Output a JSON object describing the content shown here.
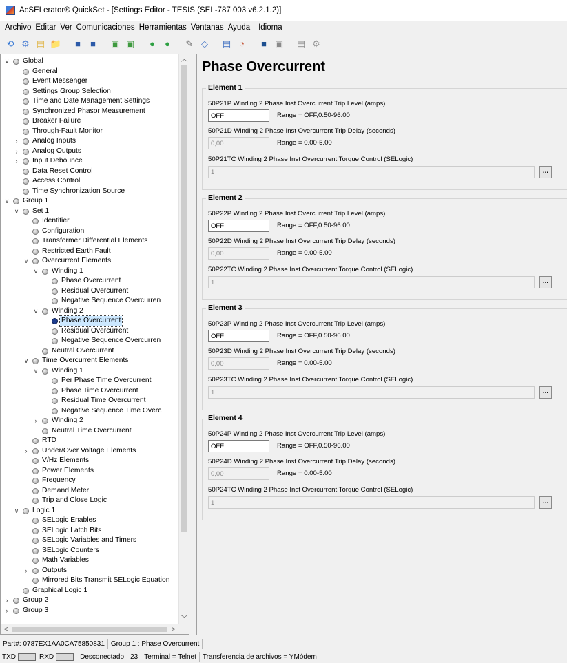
{
  "window": {
    "title": "AcSELerator® QuickSet - [Settings Editor - TESIS (SEL-787 003 v6.2.1.2)]"
  },
  "menu": [
    "Archivo",
    "Editar",
    "Ver",
    "Comunicaciones",
    "Herramientas",
    "Ventanas",
    "Ayuda",
    "Idioma"
  ],
  "toolbar": {
    "icons": [
      "connect-icon",
      "settings-icon",
      "new-file-icon",
      "open-folder-icon",
      "save-icon",
      "save-as-icon",
      "read-icon",
      "send-icon",
      "green-circle-icon",
      "green-arrow-icon",
      "abc-icon",
      "hmi-icon",
      "settings-driver-icon",
      "event-icon",
      "terminal-icon",
      "compare-icon",
      "print-icon",
      "gear-icon"
    ],
    "glyphs": [
      "⟲",
      "⚙",
      "▤",
      "📁",
      "■",
      "■",
      "▣",
      "▣",
      "●",
      "●",
      "✎",
      "◇",
      "▤",
      "◔",
      "■",
      "▣",
      "▤",
      "⚙"
    ],
    "colors": [
      "#3a7bd5",
      "#5c8ad6",
      "#e0b64a",
      "#e6c14d",
      "#2c5aa8",
      "#2c5aa8",
      "#3f9a3f",
      "#3f9a3f",
      "#2ea043",
      "#2ea043",
      "#6a6a6a",
      "#4a7ac8",
      "#3f6fc0",
      "#c4573a",
      "#1d4f8f",
      "#8a8a8a",
      "#8a8a8a",
      "#9a9a9a"
    ]
  },
  "tree": [
    {
      "label": "Global",
      "depth": 0,
      "exp": "open"
    },
    {
      "label": "General",
      "depth": 1
    },
    {
      "label": "Event Messenger",
      "depth": 1
    },
    {
      "label": "Settings Group Selection",
      "depth": 1
    },
    {
      "label": "Time and Date Management Settings",
      "depth": 1
    },
    {
      "label": "Synchronized Phasor Measurement",
      "depth": 1
    },
    {
      "label": "Breaker Failure",
      "depth": 1
    },
    {
      "label": "Through-Fault Monitor",
      "depth": 1
    },
    {
      "label": "Analog Inputs",
      "depth": 1,
      "exp": "closed"
    },
    {
      "label": "Analog Outputs",
      "depth": 1,
      "exp": "closed"
    },
    {
      "label": "Input Debounce",
      "depth": 1,
      "exp": "closed"
    },
    {
      "label": "Data Reset Control",
      "depth": 1
    },
    {
      "label": "Access Control",
      "depth": 1
    },
    {
      "label": "Time Synchronization Source",
      "depth": 1
    },
    {
      "label": "Group 1",
      "depth": 0,
      "exp": "open"
    },
    {
      "label": "Set 1",
      "depth": 1,
      "exp": "open"
    },
    {
      "label": "Identifier",
      "depth": 2
    },
    {
      "label": "Configuration",
      "depth": 2
    },
    {
      "label": "Transformer Differential Elements",
      "depth": 2
    },
    {
      "label": "Restricted Earth Fault",
      "depth": 2
    },
    {
      "label": "Overcurrent Elements",
      "depth": 2,
      "exp": "open"
    },
    {
      "label": "Winding 1",
      "depth": 3,
      "exp": "open"
    },
    {
      "label": "Phase Overcurrent",
      "depth": 4
    },
    {
      "label": "Residual Overcurrent",
      "depth": 4
    },
    {
      "label": "Negative Sequence Overcurren",
      "depth": 4
    },
    {
      "label": "Winding 2",
      "depth": 3,
      "exp": "open"
    },
    {
      "label": "Phase Overcurrent",
      "depth": 4,
      "selected": true
    },
    {
      "label": "Residual Overcurrent",
      "depth": 4
    },
    {
      "label": "Negative Sequence Overcurren",
      "depth": 4
    },
    {
      "label": "Neutral Overcurrent",
      "depth": 3
    },
    {
      "label": "Time Overcurrent Elements",
      "depth": 2,
      "exp": "open"
    },
    {
      "label": "Winding 1",
      "depth": 3,
      "exp": "open"
    },
    {
      "label": "Per Phase Time Overcurrent",
      "depth": 4
    },
    {
      "label": "Phase Time Overcurrent",
      "depth": 4
    },
    {
      "label": "Residual Time Overcurrent",
      "depth": 4
    },
    {
      "label": "Negative Sequence Time Overc",
      "depth": 4
    },
    {
      "label": "Winding 2",
      "depth": 3,
      "exp": "closed"
    },
    {
      "label": "Neutral Time Overcurrent",
      "depth": 3
    },
    {
      "label": "RTD",
      "depth": 2
    },
    {
      "label": "Under/Over Voltage Elements",
      "depth": 2,
      "exp": "closed"
    },
    {
      "label": "V/Hz Elements",
      "depth": 2
    },
    {
      "label": "Power Elements",
      "depth": 2
    },
    {
      "label": "Frequency",
      "depth": 2
    },
    {
      "label": "Demand Meter",
      "depth": 2
    },
    {
      "label": "Trip and Close Logic",
      "depth": 2
    },
    {
      "label": "Logic 1",
      "depth": 1,
      "exp": "open"
    },
    {
      "label": "SELogic Enables",
      "depth": 2
    },
    {
      "label": "SELogic Latch Bits",
      "depth": 2
    },
    {
      "label": "SELogic Variables and Timers",
      "depth": 2
    },
    {
      "label": "SELogic Counters",
      "depth": 2
    },
    {
      "label": "Math Variables",
      "depth": 2
    },
    {
      "label": "Outputs",
      "depth": 2,
      "exp": "closed"
    },
    {
      "label": "Mirrored Bits Transmit SELogic Equation",
      "depth": 2
    },
    {
      "label": "Graphical Logic 1",
      "depth": 1
    },
    {
      "label": "Group 2",
      "depth": 0,
      "exp": "closed"
    },
    {
      "label": "Group 3",
      "depth": 0,
      "exp": "closed"
    }
  ],
  "editor": {
    "title": "Phase Overcurrent",
    "elements": [
      {
        "title": "Element 1",
        "level_label": "50P21P  Winding 2 Phase Inst Overcurrent Trip Level (amps)",
        "level_value": "OFF",
        "level_range": "Range = OFF,0.50-96.00",
        "delay_label": "50P21D  Winding 2 Phase Inst Overcurrent Trip Delay (seconds)",
        "delay_value": "0,00",
        "delay_range": "Range = 0.00-5.00",
        "tc_label": "50P21TC  Winding 2 Phase Inst Overcurrent Torque Control (SELogic)",
        "tc_value": "1",
        "button": "..."
      },
      {
        "title": "Element 2",
        "level_label": "50P22P  Winding 2 Phase Inst Overcurrent Trip Level (amps)",
        "level_value": "OFF",
        "level_range": "Range = OFF,0.50-96.00",
        "delay_label": "50P22D  Winding 2 Phase Inst Overcurrent Trip Delay (seconds)",
        "delay_value": "0,00",
        "delay_range": "Range = 0.00-5.00",
        "tc_label": "50P22TC  Winding 2 Phase Inst Overcurrent Torque Control (SELogic)",
        "tc_value": "1",
        "button": "..."
      },
      {
        "title": "Element 3",
        "level_label": "50P23P  Winding 2 Phase Inst Overcurrent Trip Level (amps)",
        "level_value": "OFF",
        "level_range": "Range = OFF,0.50-96.00",
        "delay_label": "50P23D  Winding 2 Phase Inst Overcurrent Trip Delay (seconds)",
        "delay_value": "0,00",
        "delay_range": "Range = 0.00-5.00",
        "tc_label": "50P23TC  Winding 2 Phase Inst Overcurrent Torque Control (SELogic)",
        "tc_value": "1",
        "button": "..."
      },
      {
        "title": "Element 4",
        "level_label": "50P24P  Winding 2 Phase Inst Overcurrent Trip Level (amps)",
        "level_value": "OFF",
        "level_range": "Range = OFF,0.50-96.00",
        "delay_label": "50P24D  Winding 2 Phase Inst Overcurrent Trip Delay (seconds)",
        "delay_value": "0,00",
        "delay_range": "Range = 0.00-5.00",
        "tc_label": "50P24TC  Winding 2 Phase Inst Overcurrent Torque Control (SELogic)",
        "tc_value": "1",
        "button": "..."
      }
    ]
  },
  "status1": [
    "Part#: 0787EX1AA0CA75850831",
    "Group 1 : Phase Overcurrent"
  ],
  "status2": {
    "txd": "TXD",
    "rxd": "RXD",
    "connection": "Desconectado",
    "port": "23",
    "terminal": "Terminal = Telnet",
    "transfer": "Transferencia de archivos = YMódem"
  }
}
